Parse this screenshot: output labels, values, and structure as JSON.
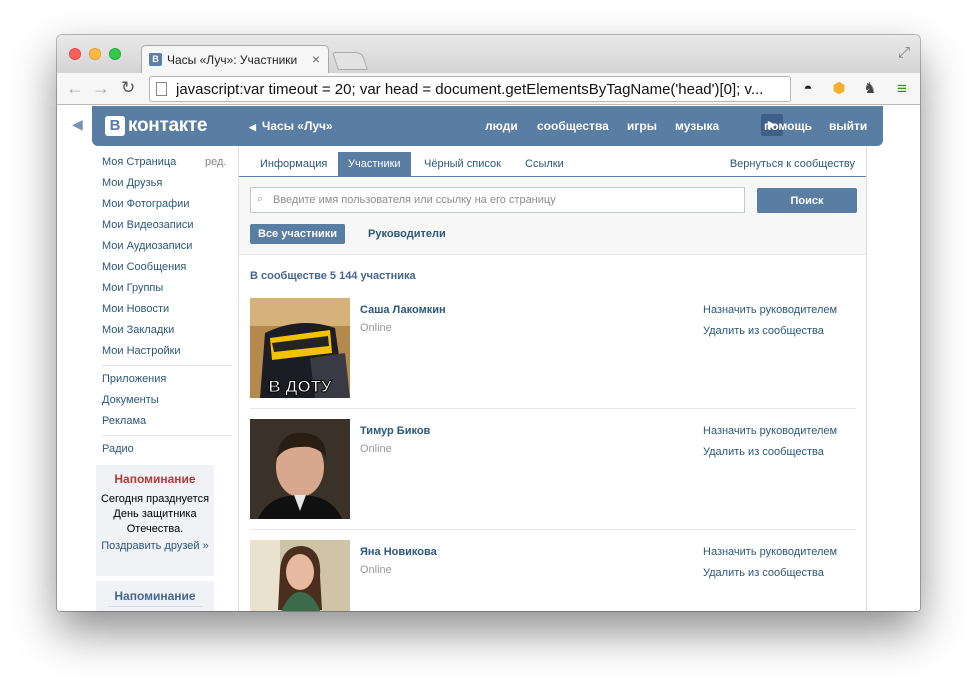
{
  "browser": {
    "tab_title": "Часы «Луч»: Участники",
    "tab_favicon": "В",
    "tab_close": "×",
    "url": "javascript:var timeout = 20; var head = document.getElementsByTagName('head')[0]; v..."
  },
  "header": {
    "logo_letter": "В",
    "logo_text": "контакте",
    "group_name": "Часы «Луч»",
    "nav": [
      "люди",
      "сообщества",
      "игры",
      "музыка",
      "помощь",
      "выйти"
    ]
  },
  "sidebar": {
    "items": [
      "Моя Страница",
      "Мои Друзья",
      "Мои Фотографии",
      "Мои Видеозаписи",
      "Мои Аудиозаписи",
      "Мои Сообщения",
      "Мои Группы",
      "Мои Новости",
      "Мои Закладки",
      "Мои Настройки"
    ],
    "edit_label": "ред.",
    "extra_items": [
      "Приложения",
      "Документы",
      "Реклама"
    ],
    "radio": "Радио",
    "reminder": {
      "title": "Напоминание",
      "text": "Сегодня празднуется День защитника Отечества.",
      "link": "Поздравить друзей »"
    },
    "reminder2_title": "Напоминание"
  },
  "content": {
    "tabs": [
      "Информация",
      "Участники",
      "Чёрный список",
      "Ссылки"
    ],
    "back_link": "Вернуться к сообществу",
    "search_placeholder": "Введите имя пользователя или ссылку на его страницу",
    "search_button": "Поиск",
    "filter_all": "Все участники",
    "filter_managers": "Руководители",
    "count_text": "В сообществе 5 144 участника",
    "members": [
      {
        "name": "Саша Лакомкин",
        "status": "Online",
        "action1": "Назначить руководителем",
        "action2": "Удалить из сообщества",
        "avatar_caption": "В ДОТУ"
      },
      {
        "name": "Тимур Биков",
        "status": "Online",
        "action1": "Назначить руководителем",
        "action2": "Удалить из сообщества"
      },
      {
        "name": "Яна Новикова",
        "status": "Online",
        "action1": "Назначить руководителем",
        "action2": "Удалить из сообщества"
      }
    ]
  },
  "icons": {
    "back": "←",
    "forward": "→",
    "reload": "↻",
    "ext_mask": "◓",
    "ext_box": "⬢",
    "ext_chess": "♞",
    "menu": "≡",
    "fullscreen": "⤢",
    "search": "⌕",
    "triangle_left": "◀",
    "play": "▶"
  },
  "colors": {
    "brand": "#597da3",
    "link": "#2b587a",
    "reminder_title": "#b33a3a"
  }
}
